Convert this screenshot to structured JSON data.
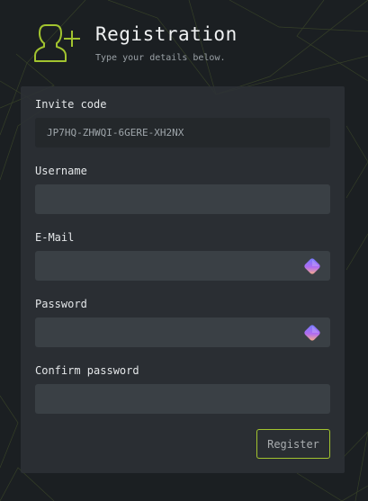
{
  "header": {
    "icon": "add-user-icon",
    "title": "Registration",
    "subtitle": "Type your details below."
  },
  "form": {
    "invite_code": {
      "label": "Invite code",
      "value": "JP7HQ-ZHWQI-6GERE-XH2NX"
    },
    "username": {
      "label": "Username",
      "value": ""
    },
    "email": {
      "label": "E-Mail",
      "value": "",
      "icon": "password-manager-icon"
    },
    "password": {
      "label": "Password",
      "value": "",
      "icon": "password-manager-icon"
    },
    "confirm_password": {
      "label": "Confirm password",
      "value": ""
    },
    "register_label": "Register"
  },
  "colors": {
    "background": "#1b1f22",
    "card": "#2c3135",
    "field": "#3a4045",
    "accent": "#a2c42f"
  }
}
